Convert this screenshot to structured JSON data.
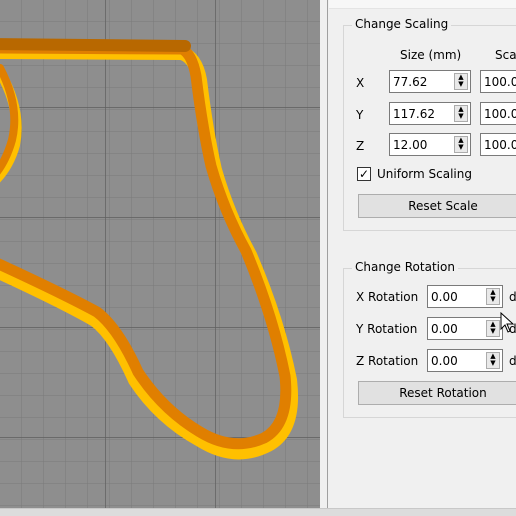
{
  "scaling": {
    "title": "Change Scaling",
    "size_header": "Size (mm)",
    "scale_header": "Sca",
    "rows": [
      {
        "axis": "X",
        "size": "77.62",
        "scale": "100.0"
      },
      {
        "axis": "Y",
        "size": "117.62",
        "scale": "100.0"
      },
      {
        "axis": "Z",
        "size": "12.00",
        "scale": "100.0"
      }
    ],
    "uniform_label": "Uniform Scaling",
    "uniform_checked": true,
    "check_glyph": "✓",
    "reset_label": "Reset Scale"
  },
  "rotation": {
    "title": "Change Rotation",
    "rows": [
      {
        "label": "X Rotation",
        "value": "0.00",
        "unit": "d"
      },
      {
        "label": "Y Rotation",
        "value": "0.00",
        "unit": "d"
      },
      {
        "label": "Z Rotation",
        "value": "0.00",
        "unit": "d"
      }
    ],
    "reset_label": "Reset Rotation"
  },
  "colors": {
    "model_dark": "#e07f00",
    "model_light": "#ffc000",
    "grid_bg": "#8e8e8e"
  },
  "icons": {
    "spin_up": "▲",
    "spin_down": "▼",
    "cursor": "arrow-cursor-icon"
  }
}
